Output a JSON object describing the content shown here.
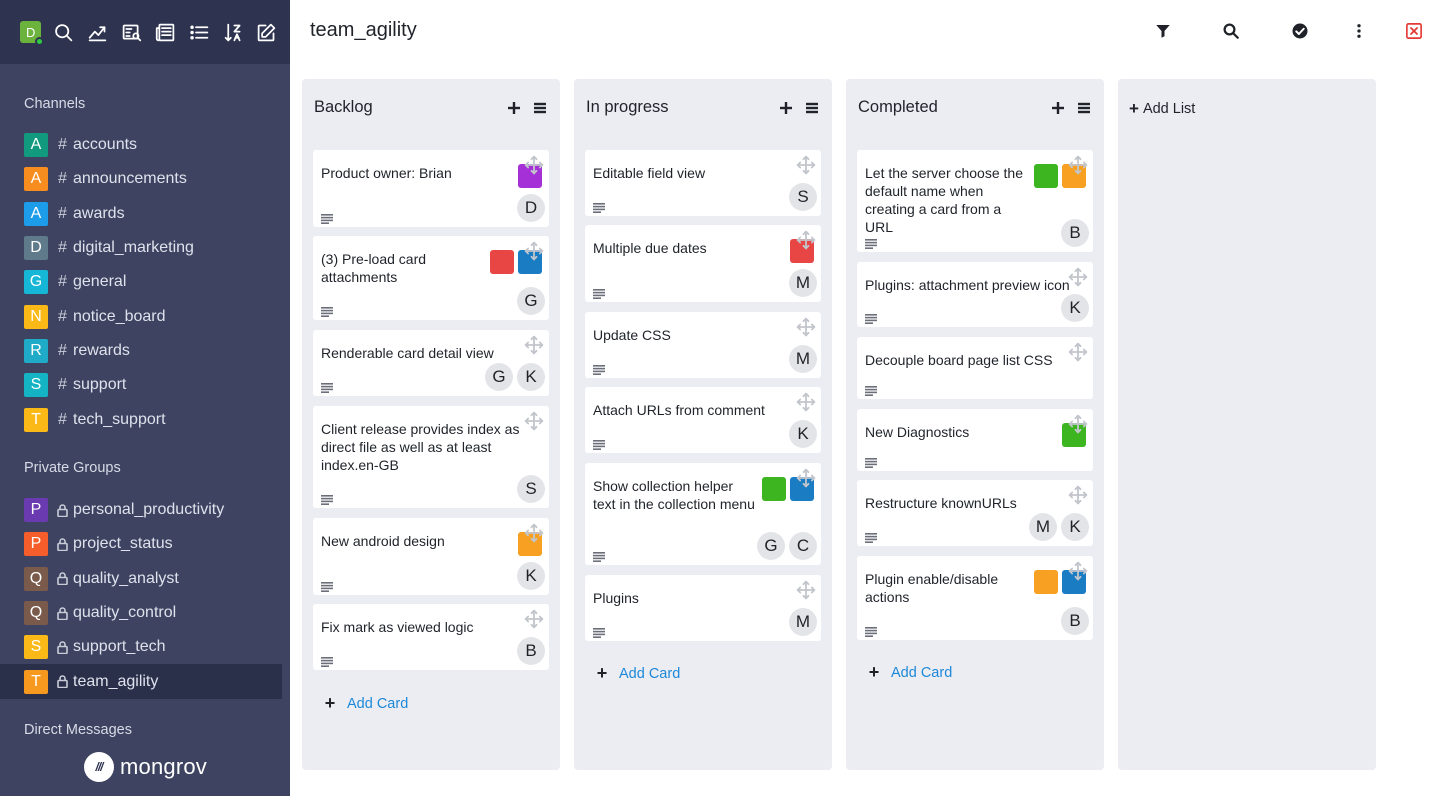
{
  "app": {
    "user_initial": "D",
    "colors": {
      "sidebar": "#3d4360",
      "sidebar_top": "#2e3350",
      "link": "#1d88d8",
      "close": "#e53935"
    }
  },
  "sidebar": {
    "channels_heading": "Channels",
    "channels": [
      {
        "letter": "A",
        "name": "accounts",
        "color": "#129a7e"
      },
      {
        "letter": "A",
        "name": "announcements",
        "color": "#f78c1f"
      },
      {
        "letter": "A",
        "name": "awards",
        "color": "#1d9ce9"
      },
      {
        "letter": "D",
        "name": "digital_marketing",
        "color": "#5f7a8a"
      },
      {
        "letter": "G",
        "name": "general",
        "color": "#16b6d6"
      },
      {
        "letter": "N",
        "name": "notice_board",
        "color": "#fbb917"
      },
      {
        "letter": "R",
        "name": "rewards",
        "color": "#1fabc7"
      },
      {
        "letter": "S",
        "name": "support",
        "color": "#14b4c5"
      },
      {
        "letter": "T",
        "name": "tech_support",
        "color": "#fbb917"
      }
    ],
    "groups_heading": "Private Groups",
    "groups": [
      {
        "letter": "P",
        "name": "personal_productivity",
        "color": "#6a3ab0",
        "active": false
      },
      {
        "letter": "P",
        "name": "project_status",
        "color": "#f55e2a",
        "active": false
      },
      {
        "letter": "Q",
        "name": "quality_analyst",
        "color": "#7a5a4a",
        "active": false
      },
      {
        "letter": "Q",
        "name": "quality_control",
        "color": "#7a5a4a",
        "active": false
      },
      {
        "letter": "S",
        "name": "support_tech",
        "color": "#fbb917",
        "active": false
      },
      {
        "letter": "T",
        "name": "team_agility",
        "color": "#f7991f",
        "active": true
      }
    ],
    "dm_heading": "Direct Messages",
    "brand": "mongrov",
    "brand_mark": "///"
  },
  "header": {
    "title": "team_agility"
  },
  "board": {
    "lists": [
      {
        "title": "Backlog",
        "add_card": "Add Card",
        "cards": [
          {
            "title": "Product owner: Brian",
            "labels": [
              "#a530d8"
            ],
            "members": [
              "D"
            ]
          },
          {
            "title": "(3) Pre-load card attachments",
            "labels": [
              "#e84545",
              "#1a7dc4"
            ],
            "members": [
              "G"
            ]
          },
          {
            "title": "Renderable card detail view",
            "labels": [],
            "members": [
              "G",
              "K"
            ]
          },
          {
            "title": "Client release provides index as direct file as well as at least index.en-GB",
            "labels": [],
            "members": [
              "S"
            ]
          },
          {
            "title": "New android design",
            "labels": [
              "#f7a022"
            ],
            "members": [
              "K"
            ]
          },
          {
            "title": "Fix mark as viewed logic",
            "labels": [],
            "members": [
              "B"
            ]
          }
        ]
      },
      {
        "title": "In progress",
        "add_card": "Add Card",
        "cards": [
          {
            "title": "Editable field view",
            "labels": [],
            "members": [
              "S"
            ]
          },
          {
            "title": "Multiple due dates",
            "labels": [
              "#e84545"
            ],
            "members": [
              "M"
            ]
          },
          {
            "title": "Update CSS",
            "labels": [],
            "members": [
              "M"
            ]
          },
          {
            "title": "Attach URLs from comment",
            "labels": [],
            "members": [
              "K"
            ]
          },
          {
            "title": "Show collection helper text in the collection menu",
            "labels": [
              "#3cb521",
              "#1a7dc4"
            ],
            "members": [
              "G",
              "C"
            ]
          },
          {
            "title": "Plugins",
            "labels": [],
            "members": [
              "M"
            ]
          }
        ]
      },
      {
        "title": "Completed",
        "add_card": "Add Card",
        "cards": [
          {
            "title": "Let the server choose the default name when creating a card from a URL",
            "labels": [
              "#3cb521",
              "#f7a022"
            ],
            "members": [
              "B"
            ]
          },
          {
            "title": "Plugins: attachment preview icon",
            "labels": [],
            "members": [
              "K"
            ]
          },
          {
            "title": "Decouple board page list CSS",
            "labels": [],
            "members": []
          },
          {
            "title": "New Diagnostics",
            "labels": [
              "#3cb521"
            ],
            "members": []
          },
          {
            "title": "Restructure knownURLs",
            "labels": [],
            "members": [
              "M",
              "K"
            ]
          },
          {
            "title": "Plugin enable/disable actions",
            "labels": [
              "#f7a022",
              "#1a7dc4"
            ],
            "members": [
              "B"
            ]
          }
        ]
      }
    ],
    "add_list": "Add List"
  }
}
